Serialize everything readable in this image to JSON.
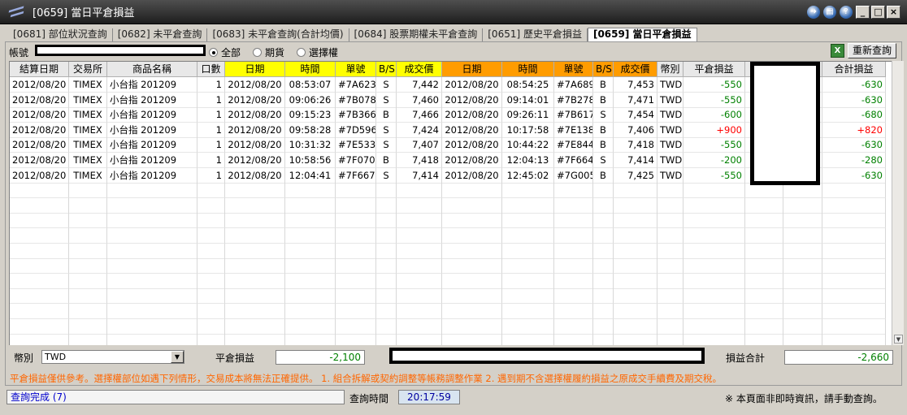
{
  "window": {
    "title": "[0659] 當日平倉損益",
    "help_icon": "?"
  },
  "tabs": [
    {
      "label": "[0681] 部位狀況查詢",
      "active": false
    },
    {
      "label": "[0682] 未平倉查詢",
      "active": false
    },
    {
      "label": "[0683] 未平倉查詢(合計均價)",
      "active": false
    },
    {
      "label": "[0684] 股票期權未平倉查詢",
      "active": false
    },
    {
      "label": "[0651] 歷史平倉損益",
      "active": false
    },
    {
      "label": "[0659] 當日平倉損益",
      "active": true
    }
  ],
  "filter": {
    "account_label": "帳號",
    "radios": [
      {
        "label": "全部",
        "checked": true
      },
      {
        "label": "期貨",
        "checked": false
      },
      {
        "label": "選擇權",
        "checked": false
      }
    ],
    "excel_label": "X",
    "refresh_label": "重新查詢"
  },
  "table": {
    "headers": [
      "結算日期",
      "交易所",
      "商品名稱",
      "口數",
      "日期",
      "時間",
      "單號",
      "B/S",
      "成交價",
      "日期",
      "時間",
      "單號",
      "B/S",
      "成交價",
      "幣別",
      "平倉損益",
      "",
      "",
      "合計損益"
    ],
    "rows": [
      [
        "2012/08/20",
        "TIMEX",
        "小台指 201209",
        "1",
        "2012/08/20",
        "08:53:07",
        "#7A623",
        "S",
        "7,442",
        "2012/08/20",
        "08:54:25",
        "#7A689",
        "B",
        "7,453",
        "TWD",
        "-550",
        "",
        "",
        "-630"
      ],
      [
        "2012/08/20",
        "TIMEX",
        "小台指 201209",
        "1",
        "2012/08/20",
        "09:06:26",
        "#7B078",
        "S",
        "7,460",
        "2012/08/20",
        "09:14:01",
        "#7B278",
        "B",
        "7,471",
        "TWD",
        "-550",
        "",
        "",
        "-630"
      ],
      [
        "2012/08/20",
        "TIMEX",
        "小台指 201209",
        "1",
        "2012/08/20",
        "09:15:23",
        "#7B366",
        "B",
        "7,466",
        "2012/08/20",
        "09:26:11",
        "#7B617",
        "S",
        "7,454",
        "TWD",
        "-600",
        "",
        "",
        "-680"
      ],
      [
        "2012/08/20",
        "TIMEX",
        "小台指 201209",
        "1",
        "2012/08/20",
        "09:58:28",
        "#7D596",
        "S",
        "7,424",
        "2012/08/20",
        "10:17:58",
        "#7E138",
        "B",
        "7,406",
        "TWD",
        "+900",
        "",
        "",
        "+820"
      ],
      [
        "2012/08/20",
        "TIMEX",
        "小台指 201209",
        "1",
        "2012/08/20",
        "10:31:32",
        "#7E533",
        "S",
        "7,407",
        "2012/08/20",
        "10:44:22",
        "#7E844",
        "B",
        "7,418",
        "TWD",
        "-550",
        "",
        "",
        "-630"
      ],
      [
        "2012/08/20",
        "TIMEX",
        "小台指 201209",
        "1",
        "2012/08/20",
        "10:58:56",
        "#7F070",
        "B",
        "7,418",
        "2012/08/20",
        "12:04:13",
        "#7F664",
        "S",
        "7,414",
        "TWD",
        "-200",
        "",
        "",
        "-280"
      ],
      [
        "2012/08/20",
        "TIMEX",
        "小台指 201209",
        "1",
        "2012/08/20",
        "12:04:41",
        "#7F667",
        "S",
        "7,414",
        "2012/08/20",
        "12:45:02",
        "#7G005",
        "B",
        "7,425",
        "TWD",
        "-550",
        "",
        "",
        "-630"
      ]
    ]
  },
  "summary": {
    "currency_label": "幣別",
    "currency_value": "TWD",
    "close_pl_label": "平倉損益",
    "close_pl_value": "-2,100",
    "total_label": "損益合計",
    "total_value": "-2,660"
  },
  "note": "平倉損益僅供參考。選擇權部位如遇下列情形，交易成本將無法正確提供。  1. 組合拆解或契約調整等帳務調整作業  2. 遇到期不含選擇權履約損益之原成交手續費及期交稅。",
  "status": {
    "text": "查詢完成 (7)",
    "query_time_label": "查詢時間",
    "query_time": "20:17:59",
    "right_message": "※ 本頁面非即時資訊，請手動查詢。"
  }
}
